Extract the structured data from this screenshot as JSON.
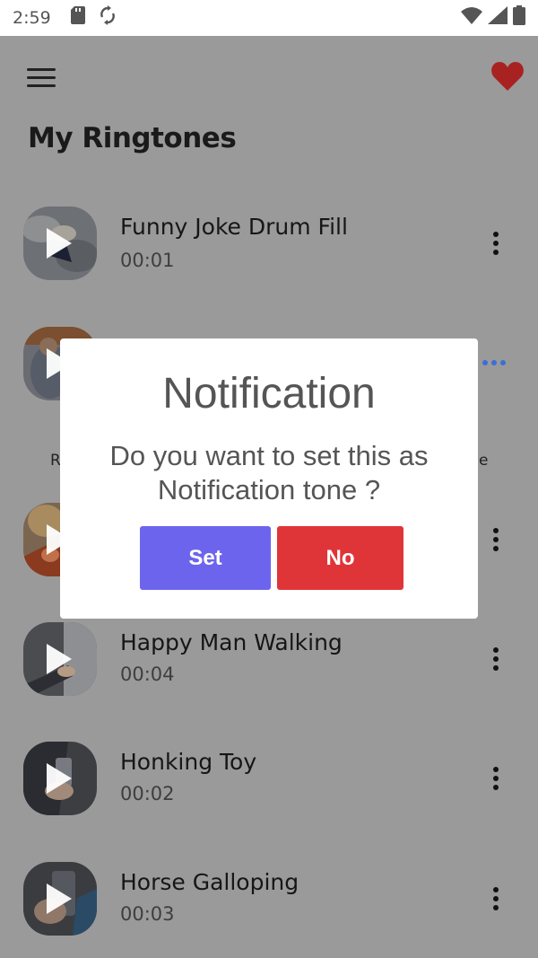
{
  "status_bar": {
    "time": "2:59",
    "icons": [
      "sd-card-icon",
      "sync-icon",
      "wifi-icon",
      "signal-icon",
      "battery-icon"
    ]
  },
  "app_bar": {
    "menu_icon": "menu-icon",
    "favorite_icon": "heart-icon",
    "favorite_color": "#c62828"
  },
  "page": {
    "title": "My Ringtones"
  },
  "ringtones": [
    {
      "title": "Funny Joke Drum Fill",
      "duration": "00:01"
    },
    {
      "title": "",
      "duration": ""
    },
    {
      "title": "",
      "duration": ""
    },
    {
      "title": "Happy Man Walking",
      "duration": "00:04"
    },
    {
      "title": "Honking Toy",
      "duration": "00:02"
    },
    {
      "title": "Horse Galloping",
      "duration": "00:03"
    }
  ],
  "obscured_text": {
    "left_fragment": "R",
    "right_fragment": "e"
  },
  "dialog": {
    "title": "Notification",
    "message": "Do you want to set this as Notification tone ?",
    "set_label": "Set",
    "no_label": "No",
    "set_color": "#6d64ee",
    "no_color": "#e03538"
  }
}
